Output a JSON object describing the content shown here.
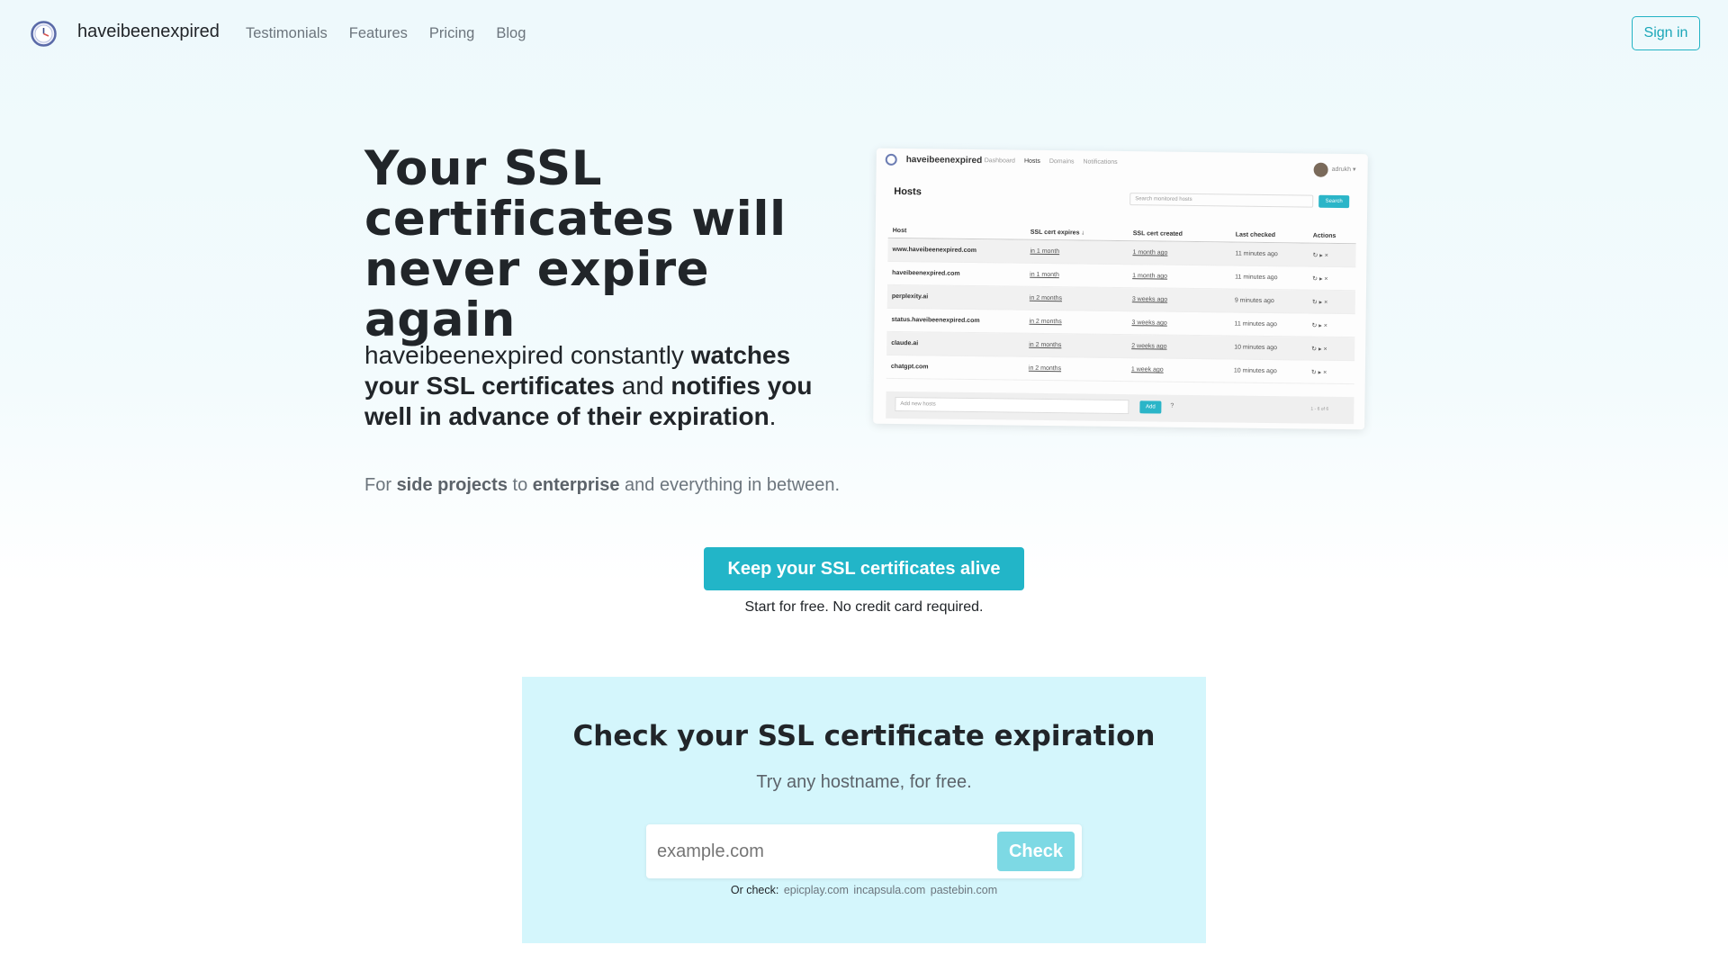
{
  "nav": {
    "brand": "haveibeenexpired",
    "links": [
      "Testimonials",
      "Features",
      "Pricing",
      "Blog"
    ],
    "signin": "Sign in"
  },
  "hero": {
    "title": "Your SSL certificates will never expire again",
    "sub_1": "haveibeenexpired constantly ",
    "sub_b1": "watches your SSL certificates",
    "sub_2": " and ",
    "sub_b2": "notifies you well in advance of their expiration",
    "sub_3": ".",
    "for_1": "For ",
    "for_b1": "side projects",
    "for_2": " to ",
    "for_b2": "enterprise",
    "for_3": " and everything in between."
  },
  "preview": {
    "brand": "haveibeenexpired",
    "navs": [
      "Dashboard",
      "Hosts",
      "Domains",
      "Notifications"
    ],
    "user": "adrukh",
    "heading": "Hosts",
    "search_placeholder": "Search monitored hosts",
    "search_button": "Search",
    "columns": [
      "Host",
      "SSL cert expires ↓",
      "SSL cert created",
      "Last checked",
      "Actions"
    ],
    "rows": [
      {
        "host": "www.haveibeenexpired.com",
        "expires": "in 1 month",
        "created": "1 month ago",
        "checked": "11 minutes ago",
        "actions": "↻ ▸ ×"
      },
      {
        "host": "haveibeenexpired.com",
        "expires": "in 1 month",
        "created": "1 month ago",
        "checked": "11 minutes ago",
        "actions": "↻ ▸ ×"
      },
      {
        "host": "perplexity.ai",
        "expires": "in 2 months",
        "created": "3 weeks ago",
        "checked": "9 minutes ago",
        "actions": "↻ ▸ ×"
      },
      {
        "host": "status.haveibeenexpired.com",
        "expires": "in 2 months",
        "created": "3 weeks ago",
        "checked": "11 minutes ago",
        "actions": "↻ ▸ ×"
      },
      {
        "host": "claude.ai",
        "expires": "in 2 months",
        "created": "2 weeks ago",
        "checked": "10 minutes ago",
        "actions": "↻ ▸ ×"
      },
      {
        "host": "chatgpt.com",
        "expires": "in 2 months",
        "created": "1 week ago",
        "checked": "10 minutes ago",
        "actions": "↻ ▸ ×"
      }
    ],
    "add_placeholder": "Add new hosts",
    "add_button": "Add",
    "help": "?",
    "pagination": "1 - 6 of 6"
  },
  "cta": {
    "button": "Keep your SSL certificates alive",
    "note": "Start for free. No credit card required."
  },
  "checker": {
    "title": "Check your SSL certificate expiration",
    "subtitle": "Try any hostname, for free.",
    "placeholder": "example.com",
    "button": "Check",
    "or_label": "Or check:",
    "suggestions": [
      "epicplay.com",
      "incapsula.com",
      "pastebin.com"
    ]
  },
  "colors": {
    "accent": "#22b5c8",
    "check_bg": "#d4f6fc"
  }
}
